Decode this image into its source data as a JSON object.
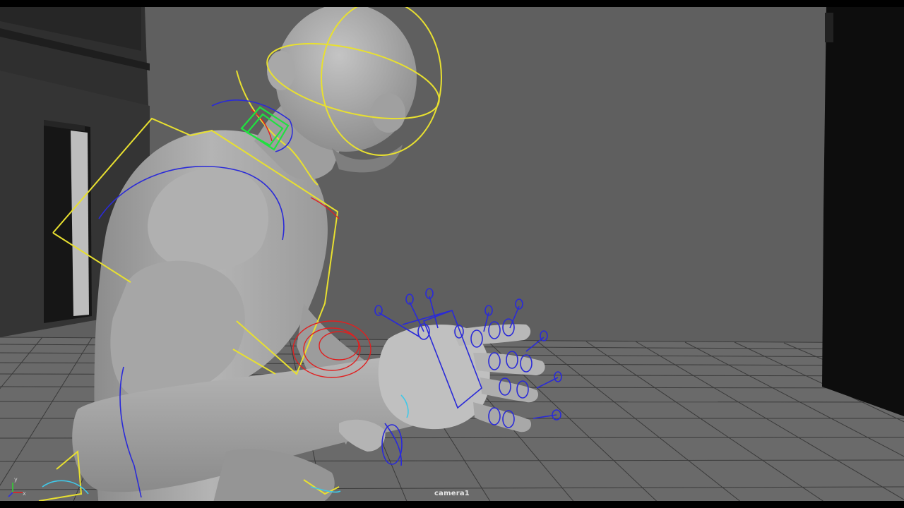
{
  "viewport": {
    "camera_name": "camera1",
    "background_color": "#5f5f5f",
    "floor_color": "#6a6a6a",
    "grid_color": "#3a3a3a",
    "axis_labels": {
      "y": "y",
      "x": "x"
    }
  },
  "rig_colors": {
    "fk_controls": "#e8e030",
    "ik_controls": "#2a2ad8",
    "selected": "#20e040",
    "rotate_manip": "#e02020",
    "secondary": "#40c8e8"
  },
  "scene_objects": [
    "character-mesh",
    "building-left",
    "building-right",
    "floor-grid"
  ]
}
